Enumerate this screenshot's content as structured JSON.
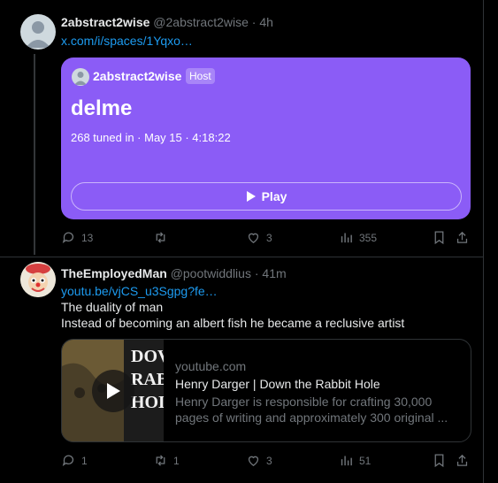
{
  "tweets": [
    {
      "display_name": "2abstract2wise",
      "handle": "@2abstract2wise",
      "separator": "·",
      "time": "4h",
      "link": "x.com/i/spaces/1Yqxo…",
      "space": {
        "host_name": "2abstract2wise",
        "host_badge": "Host",
        "title": "delme",
        "meta": "268 tuned in · May 15 · 4:18:22",
        "play_label": "Play"
      },
      "actions": {
        "replies": "13",
        "reposts": "",
        "likes": "3",
        "views": "355"
      }
    },
    {
      "display_name": "TheEmployedMan",
      "handle": "@pootwiddlius",
      "separator": "·",
      "time": "41m",
      "link": "youtu.be/vjCS_u3Sgpg?fe…",
      "lines": [
        "The duality of man",
        "Instead of becoming an albert fish he became a reclusive artist"
      ],
      "card": {
        "domain": "youtube.com",
        "title": "Henry Darger | Down the Rabbit Hole",
        "desc_line1": "Henry Darger is responsible for crafting 30,000",
        "desc_line2": "pages of writing and approximately 300 original ...",
        "thumb_text": [
          "DOV",
          "RAB",
          "HOL"
        ]
      },
      "actions": {
        "replies": "1",
        "reposts": "1",
        "likes": "3",
        "views": "51"
      }
    }
  ],
  "colors": {
    "background": "#000000",
    "space_purple": "#8b5cf6",
    "link_blue": "#1d9bf0",
    "muted": "#71767b",
    "border": "#2f3336"
  },
  "icons": [
    "reply-icon",
    "repost-icon",
    "like-icon",
    "views-icon",
    "bookmark-icon",
    "share-icon",
    "play-icon"
  ]
}
